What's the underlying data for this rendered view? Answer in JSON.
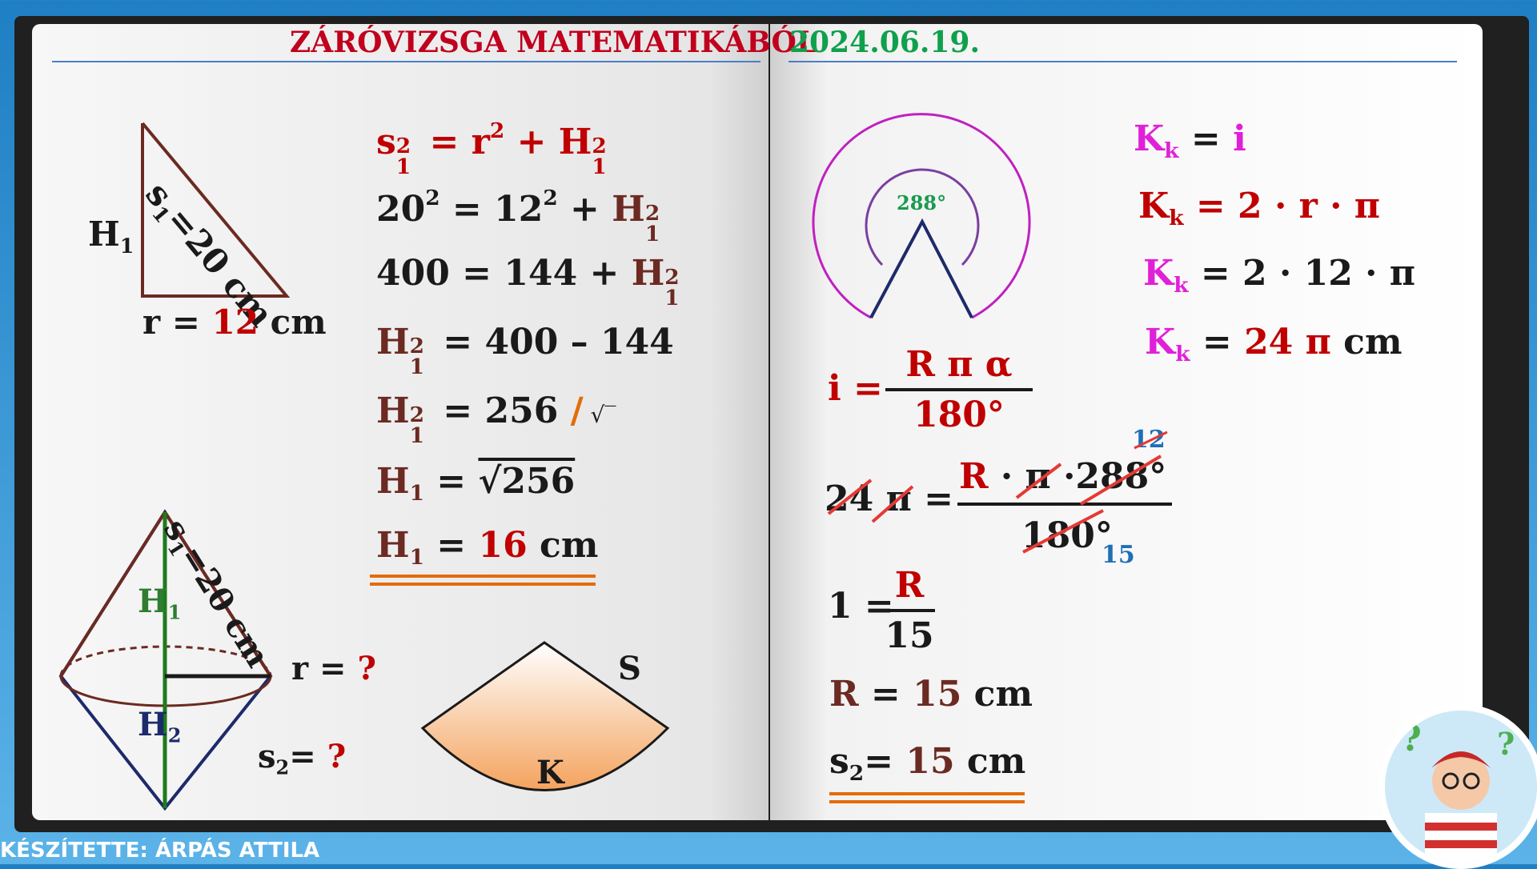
{
  "header": {
    "title": "ZÁRÓVIZSGA MATEMATIKÁBÓL",
    "date": "2024.06.19."
  },
  "footer": {
    "author": "KÉSZÍTETTE: ÁRPÁS ATTILA"
  },
  "left": {
    "triangle": {
      "h": "H",
      "h_sub": "1",
      "s": "s",
      "s_sub": "1",
      "s_val": "=20 cm",
      "r_label": "r = ",
      "r_val": "12",
      "r_unit": " cm"
    },
    "equations": {
      "l1": {
        "s": "s",
        "eq": " = ",
        "r": "r",
        "sq": "2",
        "plus": " + ",
        "h": "H",
        "one": "1"
      },
      "l2": {
        "left": "20",
        "sq": "2",
        "eq": " = 12",
        "sq2": "2",
        "plus": " + ",
        "h": "H",
        "one": "1"
      },
      "l3": {
        "left": "400 = 144 + ",
        "h": "H",
        "one": "1",
        "sq": "2"
      },
      "l4": {
        "h": "H",
        "one": "1",
        "sq": "2",
        "right": " = 400 –  144"
      },
      "l5": {
        "h": "H",
        "one": "1",
        "sq": "2",
        "right": " = 256  ",
        "slash": "/",
        "root": " √‾"
      },
      "l6": {
        "h": "H",
        "one": "1",
        "eq": " = ",
        "root": "√256"
      },
      "l7": {
        "h": "H",
        "one": "1",
        "eq": " = ",
        "val": "16",
        "unit": "  cm"
      }
    },
    "cone": {
      "s": "s",
      "s_sub": "1",
      "s_val": "=20 cm",
      "h1": "H",
      "h1_sub": "1",
      "h2": "H",
      "h2_sub": "2",
      "r_label": "r = ",
      "r_q": "?",
      "s2": "s",
      "s2_sub": "2",
      "s2_eq": "= ",
      "s2_q": "?"
    },
    "sector": {
      "s": "S",
      "k": "K"
    }
  },
  "right": {
    "diagram": {
      "angle": "288°"
    },
    "formula_i": {
      "lhs": "i =",
      "num": "R  π  α",
      "den": "180°"
    },
    "kk": {
      "l1": {
        "k": "K",
        "sub": "k",
        "eq": " = ",
        "val": "i"
      },
      "l2": {
        "k": "K",
        "sub": "k",
        "rest": " =  2 · r  ·  π"
      },
      "l3": {
        "k": "K",
        "sub": "k",
        "rest": " =  2 · 12  ·  π"
      },
      "l4": {
        "k": "K",
        "sub": "k",
        "eq": " =  ",
        "val": "24 π",
        "unit": "  cm"
      }
    },
    "cancel": {
      "lhs_num": "24",
      "lhs_pi": "π",
      "eq": " =",
      "num_r": "R",
      "num_dot": " · ",
      "num_pi": "π",
      "num_dot2": " ·",
      "num_angle": "288°",
      "den": "180°",
      "top_small": "12",
      "bottom_small": "15"
    },
    "one": {
      "lhs": "1 =",
      "num": "R",
      "den": "15"
    },
    "result_r": {
      "lhs": "R",
      "eq": "  = ",
      "val": "15",
      "unit": "  cm"
    },
    "result_s2": {
      "s": "s",
      "sub": "2",
      "eq": "=  ",
      "val": "15",
      "unit": "  cm"
    }
  }
}
